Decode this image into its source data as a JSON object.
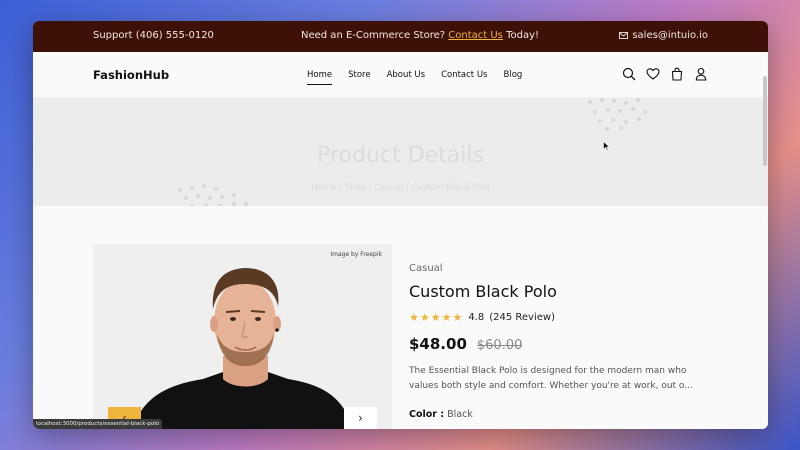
{
  "topbar": {
    "support": "Support (406) 555-0120",
    "promo_prefix": "Need an E-Commerce Store?",
    "promo_link": "Contact Us",
    "promo_suffix": "Today!",
    "email": "sales@intuio.io"
  },
  "nav": {
    "logo": "FashionHub",
    "menu": [
      "Home",
      "Store",
      "About Us",
      "Contact Us",
      "Blog"
    ],
    "active": "Home",
    "icons": [
      "search-icon",
      "heart-icon",
      "cart-icon",
      "user-icon"
    ]
  },
  "hero": {
    "title": "Product Details",
    "breadcrumb": "Home / Shop / Casual / Custom Black Polo"
  },
  "product": {
    "image_credit": "Image by Freepik",
    "category": "Casual",
    "name": "Custom Black Polo",
    "rating": "4.8",
    "stars": 5,
    "reviews": "(245 Review)",
    "price": "$48.00",
    "old_price": "$60.00",
    "description": "The Essential Black Polo is designed for the modern man who values both style and comfort. Whether you're at work, out o...",
    "color_label": "Color :",
    "color_value": "Black"
  },
  "status_url": "localhost:3000/products/essential-black-polo",
  "colors": {
    "topbar_bg": "#3d1106",
    "accent": "#f0b53d"
  }
}
